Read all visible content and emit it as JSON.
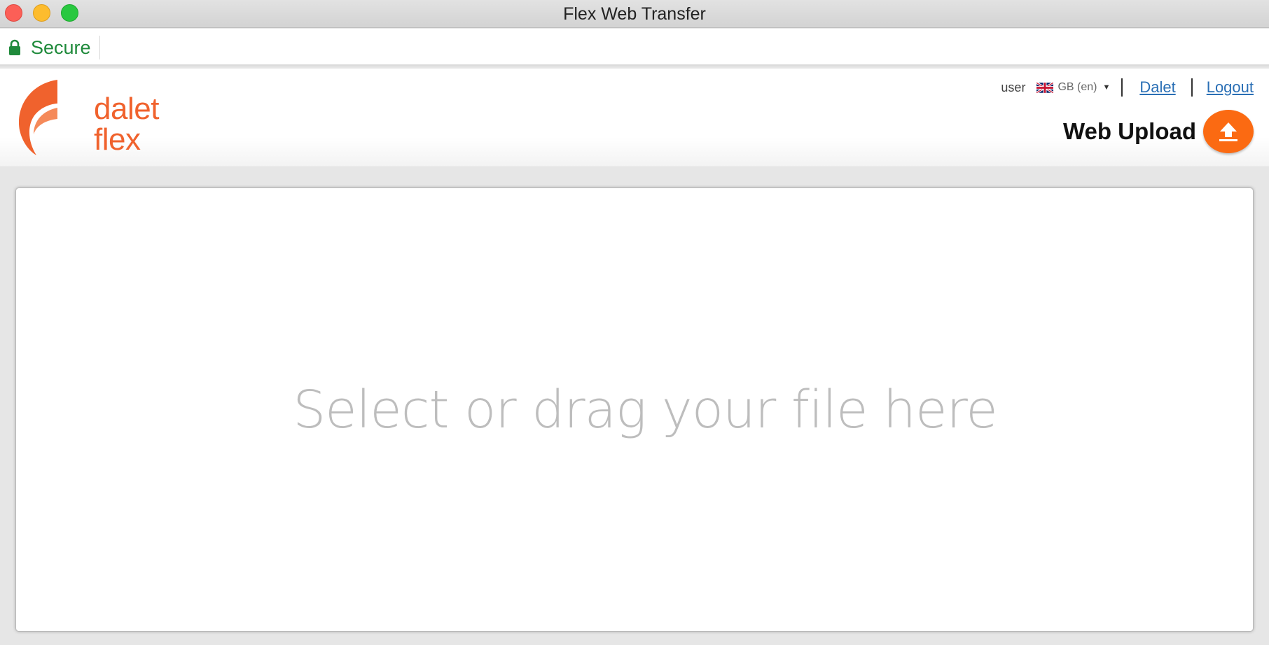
{
  "window": {
    "title": "Flex Web Transfer"
  },
  "addressbar": {
    "secure_label": "Secure"
  },
  "brand": {
    "line1": "dalet",
    "line2": "flex",
    "color": "#f0622d"
  },
  "topnav": {
    "user": "user",
    "language": "GB (en)",
    "links": [
      "Dalet",
      "Logout"
    ]
  },
  "upload": {
    "label": "Web Upload",
    "button_color": "#fb6a12",
    "icon": "upload-arrow-icon"
  },
  "dropzone": {
    "text": "Select or drag your file here"
  },
  "colors": {
    "secure": "#1f8a3b",
    "link": "#2a6fb5"
  }
}
